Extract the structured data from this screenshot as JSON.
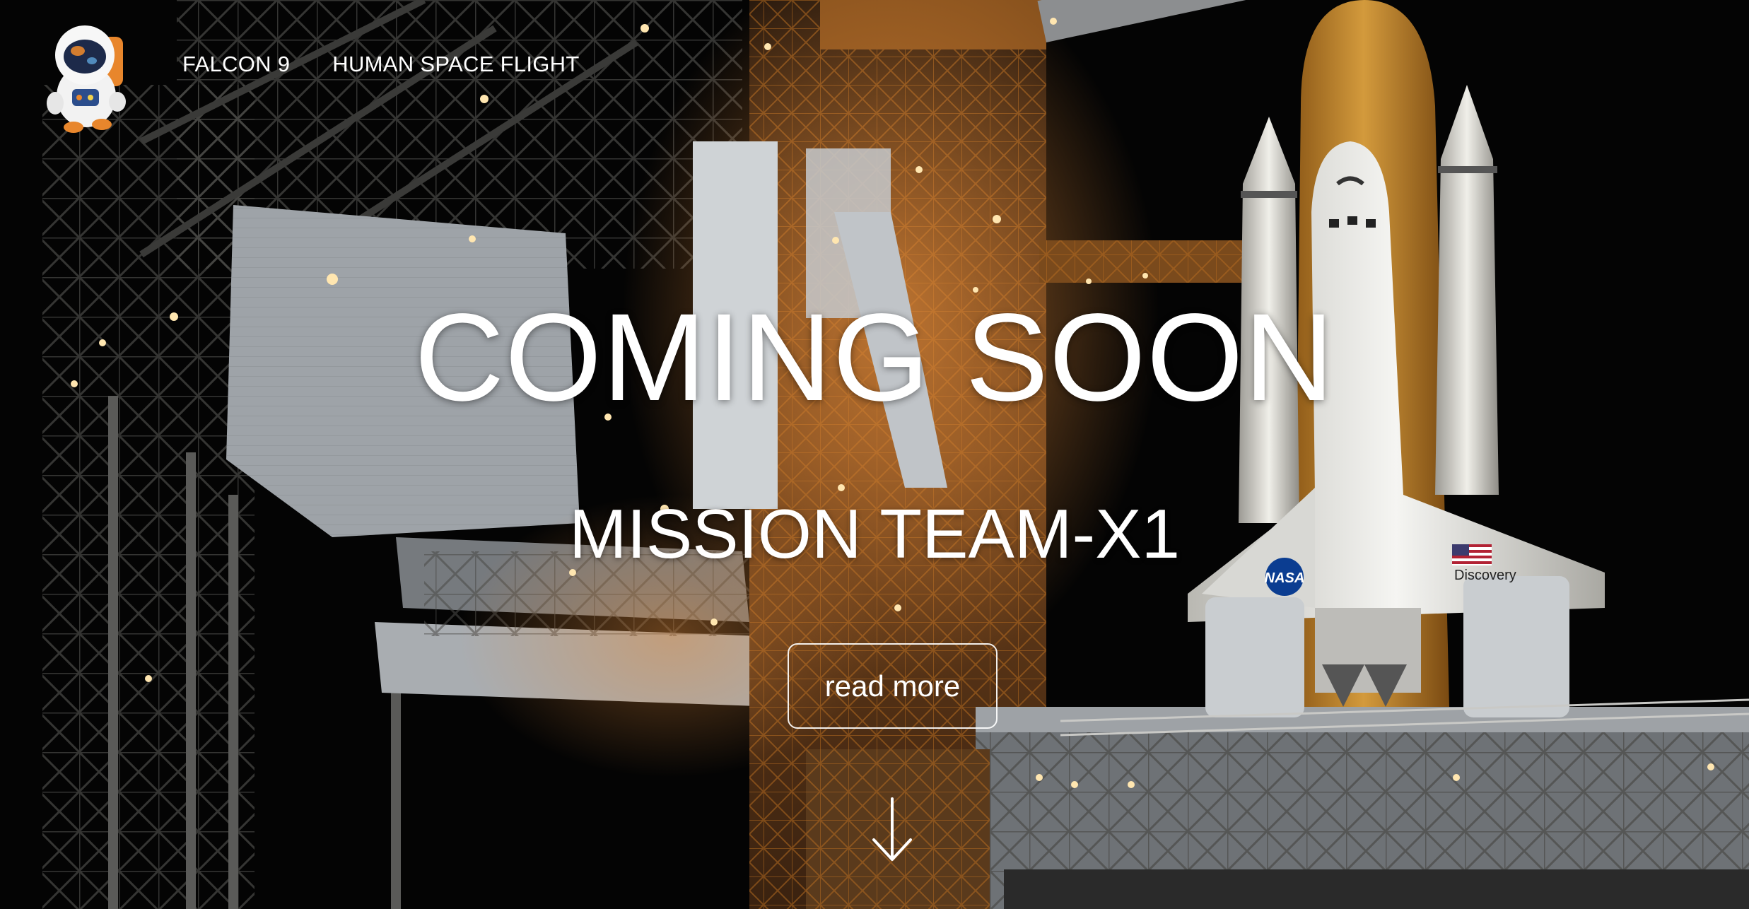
{
  "nav": {
    "items": [
      {
        "label": "FALCON 9"
      },
      {
        "label": "HUMAN SPACE FLIGHT"
      }
    ]
  },
  "hero": {
    "headline": "COMING SOON",
    "subheadline": "MISSION TEAM-X1",
    "cta_label": "read more",
    "scroll_icon": "arrow-down-icon",
    "shuttle_logo_text": "NASA",
    "shuttle_name_text": "Discovery"
  },
  "logo": {
    "icon": "astronaut-icon"
  },
  "colors": {
    "text": "#ffffff",
    "sky": "#050505",
    "gantry_glow": "#d9792a",
    "shuttle_white": "#e6e6e2",
    "external_tank": "#c88a2c"
  }
}
